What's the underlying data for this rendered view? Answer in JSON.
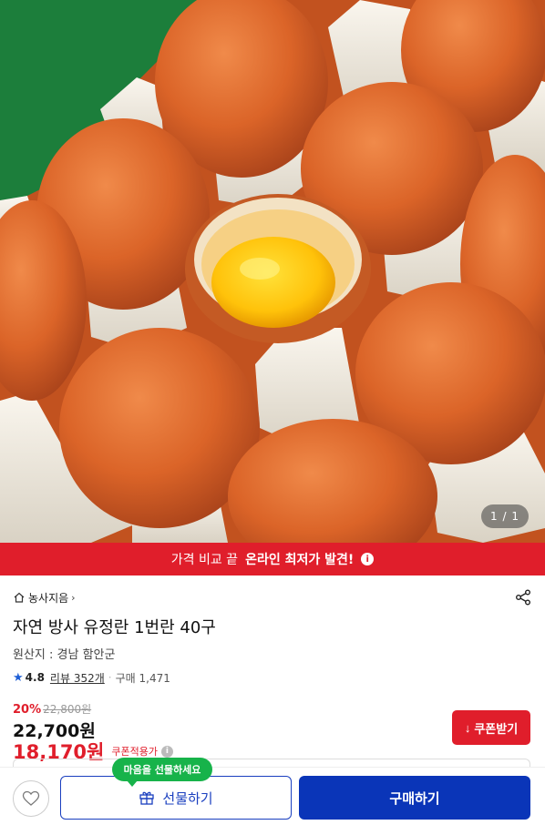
{
  "gallery": {
    "counter": "1 / 1"
  },
  "promo": {
    "text": "가격 비교 끝",
    "highlight": "온라인 최저가 발견!",
    "info_icon": "i"
  },
  "product": {
    "breadcrumb": "농사지음",
    "title": "자연 방사 유정란 1번란 40구",
    "origin": "원산지 : 경남 함안군",
    "rating": "4.8",
    "review_label": "리뷰 352개",
    "purchase_label": "구매 1,471",
    "discount_rate": "20%",
    "original_price": "22,800원",
    "sale_price": "22,700원",
    "coupon_price": "18,170원",
    "coupon_label": "쿠폰적용가",
    "coupon_info_icon": "i"
  },
  "coupon_button": {
    "label": "쿠폰받기"
  },
  "bottom_bar": {
    "gift_bubble": "마음을 선물하세요",
    "gift_label": "선물하기",
    "buy_label": "구매하기"
  },
  "colors": {
    "accent_red": "#e01e2b",
    "primary_blue": "#0a35b8",
    "bubble_green": "#17b34a"
  }
}
